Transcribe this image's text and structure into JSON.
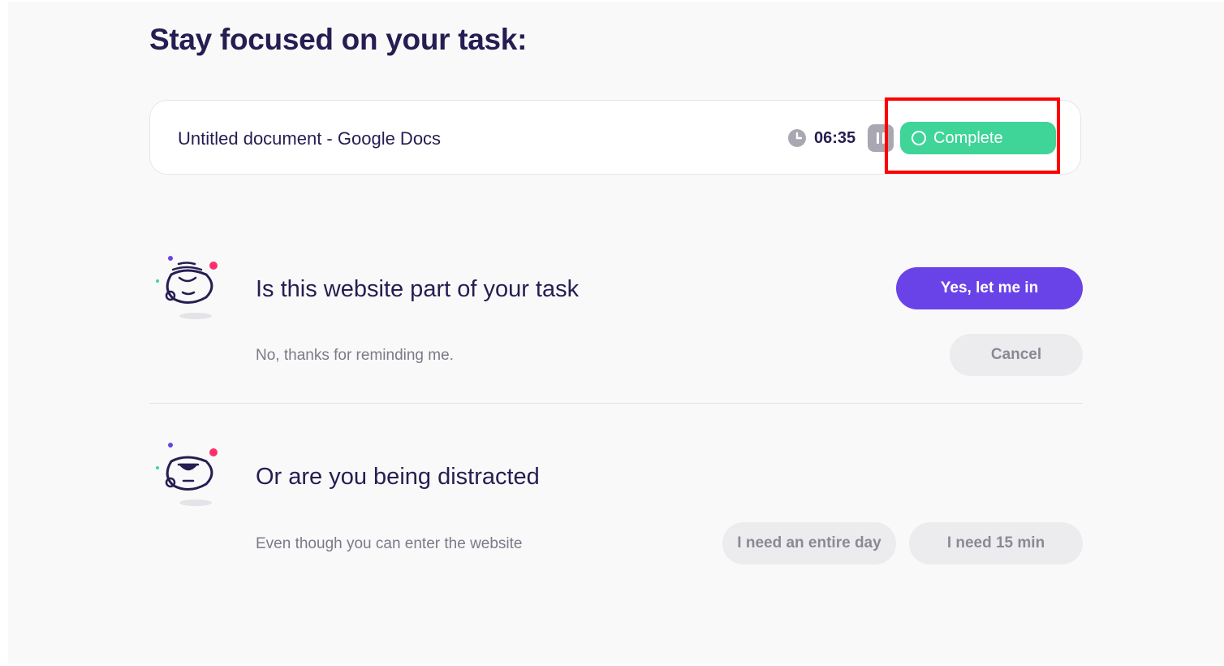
{
  "page": {
    "title": "Stay focused on your task:"
  },
  "task": {
    "name": "Untitled document - Google Docs",
    "timer": "06:35",
    "clock_icon": "clock-icon",
    "pause_icon": "pause-icon",
    "complete_label": "Complete",
    "complete_icon": "circle-icon",
    "complete_color": "#3fd498"
  },
  "part_of_task": {
    "question": "Is this website part of your task",
    "subtext": "No, thanks for reminding me.",
    "confirm_label": "Yes, let me in",
    "cancel_label": "Cancel",
    "confirm_color": "#6a43e8",
    "mascot_icon": "calm-mascot-icon"
  },
  "distracted": {
    "question": "Or are you being distracted",
    "subtext": "Even though you can enter the website",
    "entire_day_label": "I need an entire day",
    "fifteen_min_label": "I need 15 min",
    "mascot_icon": "annoyed-mascot-icon"
  },
  "colors": {
    "heading": "#261d52",
    "highlight": "#ff0000",
    "accent_pink": "#ff2f6d"
  }
}
